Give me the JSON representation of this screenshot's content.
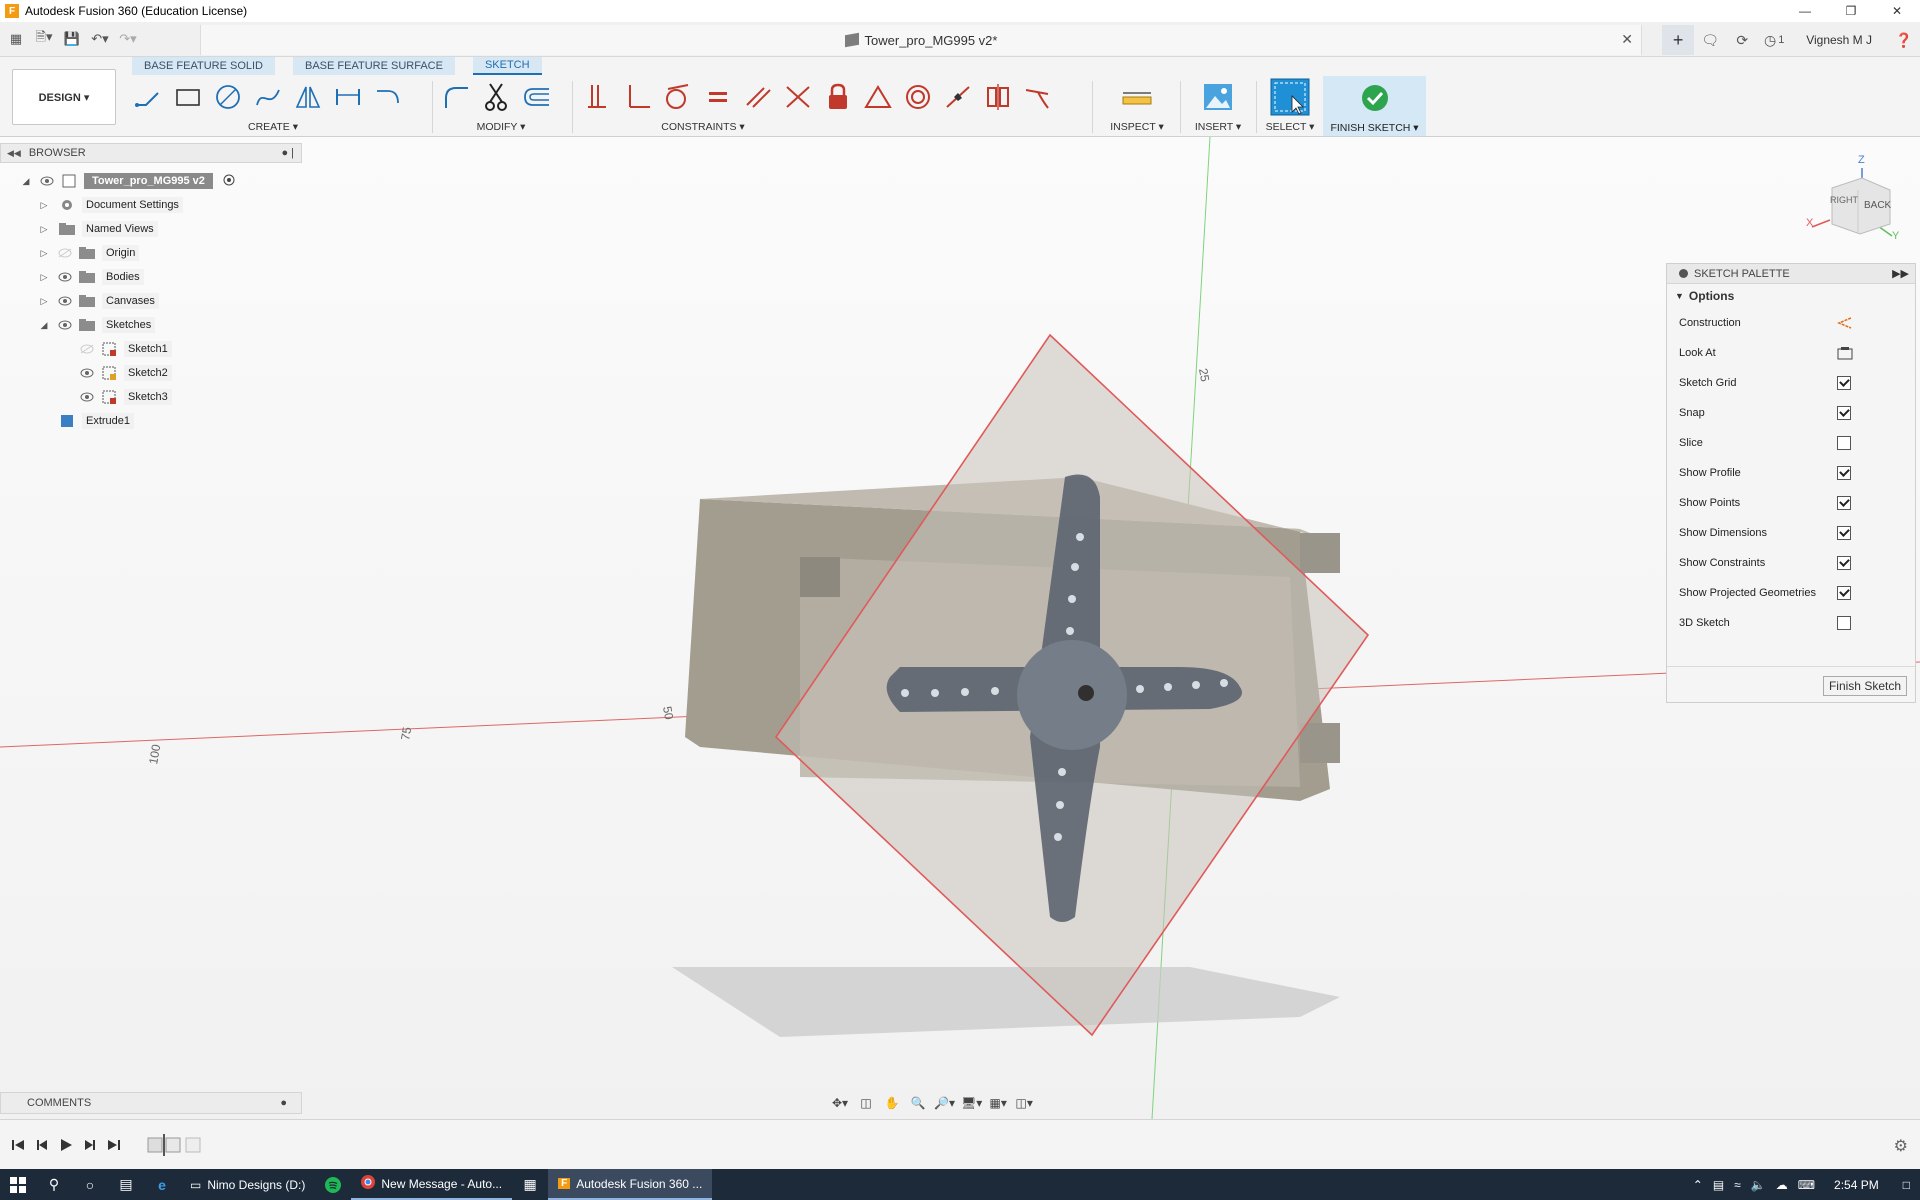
{
  "window": {
    "title": "Autodesk Fusion 360 (Education License)",
    "app_icon": "F"
  },
  "doc_tab": {
    "title": "Tower_pro_MG995 v2*"
  },
  "header_right": {
    "job_count": "1",
    "user": "Vignesh M J"
  },
  "ribbon": {
    "tabs": [
      {
        "label": "BASE FEATURE SOLID",
        "active": false
      },
      {
        "label": "BASE FEATURE SURFACE",
        "active": false
      },
      {
        "label": "SKETCH",
        "active": true
      }
    ],
    "workspace": "DESIGN ▾",
    "groups": {
      "create": "CREATE ▾",
      "modify": "MODIFY ▾",
      "constraints": "CONSTRAINTS ▾",
      "inspect": "INSPECT ▾",
      "insert": "INSERT ▾",
      "select": "SELECT ▾",
      "finish": "FINISH SKETCH ▾"
    },
    "accent_color": "#1f6fb5"
  },
  "browser": {
    "title": "BROWSER",
    "root": "Tower_pro_MG995 v2",
    "items": [
      {
        "label": "Document Settings",
        "icon": "gear-icon"
      },
      {
        "label": "Named Views",
        "icon": "folder-icon"
      },
      {
        "label": "Origin",
        "icon": "folder-icon"
      },
      {
        "label": "Bodies",
        "icon": "folder-icon"
      },
      {
        "label": "Canvases",
        "icon": "folder-icon"
      },
      {
        "label": "Sketches",
        "icon": "folder-icon"
      }
    ],
    "sketches": [
      {
        "label": "Sketch1"
      },
      {
        "label": "Sketch2"
      },
      {
        "label": "Sketch3"
      }
    ],
    "extrude": "Extrude1"
  },
  "comments": {
    "title": "COMMENTS"
  },
  "viewcube": {
    "right": "RIGHT",
    "back": "BACK",
    "axis_x": "X",
    "axis_y": "Y",
    "axis_z": "Z"
  },
  "canvas_ticks": {
    "t100": "100",
    "t75": "75",
    "t50": "50",
    "t25": "25"
  },
  "palette": {
    "title": "SKETCH PALETTE",
    "section": "Options",
    "options": [
      {
        "label": "Construction",
        "type": "icon",
        "icon": "construction-icon"
      },
      {
        "label": "Look At",
        "type": "icon",
        "icon": "look-at-icon"
      },
      {
        "label": "Sketch Grid",
        "type": "check",
        "checked": true
      },
      {
        "label": "Snap",
        "type": "check",
        "checked": true
      },
      {
        "label": "Slice",
        "type": "check",
        "checked": false
      },
      {
        "label": "Show Profile",
        "type": "check",
        "checked": true
      },
      {
        "label": "Show Points",
        "type": "check",
        "checked": true
      },
      {
        "label": "Show Dimensions",
        "type": "check",
        "checked": true
      },
      {
        "label": "Show Constraints",
        "type": "check",
        "checked": true
      },
      {
        "label": "Show Projected Geometries",
        "type": "check",
        "checked": true
      },
      {
        "label": "3D Sketch",
        "type": "check",
        "checked": false
      }
    ],
    "finish_button": "Finish Sketch"
  },
  "taskbar": {
    "apps": [
      {
        "label": "Nimo Designs (D:)",
        "state": "normal"
      },
      {
        "label": "New Message - Auto...",
        "state": "running"
      },
      {
        "label": "Autodesk Fusion 360 ...",
        "state": "active"
      }
    ],
    "time": "2:54 PM"
  }
}
